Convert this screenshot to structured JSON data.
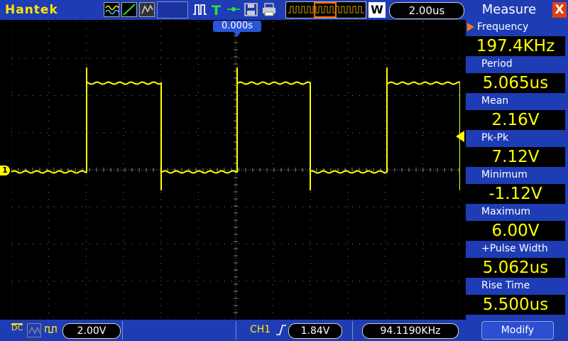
{
  "topbar": {
    "brand": "Hantek",
    "timebase": "2.00us",
    "wide_button": "W",
    "icons": [
      "waveform-mode-icon",
      "vector-mode-icon",
      "persist-mode-icon",
      "pulse-trigger-icon",
      "trigger-T-icon",
      "save-icon",
      "print-icon"
    ]
  },
  "scope": {
    "trigger_time_marker": "0.000s",
    "channel_marker": "1",
    "trace_color": "#ffff00",
    "grid_color": "#7a7a7a"
  },
  "bottombar": {
    "coupling": "DC",
    "ch1_scale": "2.00V",
    "trigger_source": "CH1",
    "trigger_level": "1.84V",
    "trigger_frequency": "94.1190KHz"
  },
  "measure": {
    "title": "Measure",
    "close_label": "X",
    "items": [
      {
        "label": "Frequency",
        "value": "197.4KHz"
      },
      {
        "label": "Period",
        "value": "5.065us"
      },
      {
        "label": "Mean",
        "value": "2.16V"
      },
      {
        "label": "Pk-Pk",
        "value": "7.12V"
      },
      {
        "label": "Minimum",
        "value": "-1.12V"
      },
      {
        "label": "Maximum",
        "value": "6.00V"
      },
      {
        "label": "+Pulse Width",
        "value": "5.062us"
      },
      {
        "label": "Rise Time",
        "value": "5.500us"
      }
    ],
    "modify_label": "Modify"
  },
  "colors": {
    "panel_blue": "#1e3cb4",
    "accent_yellow": "#ffff00",
    "close_red": "#e04010"
  }
}
